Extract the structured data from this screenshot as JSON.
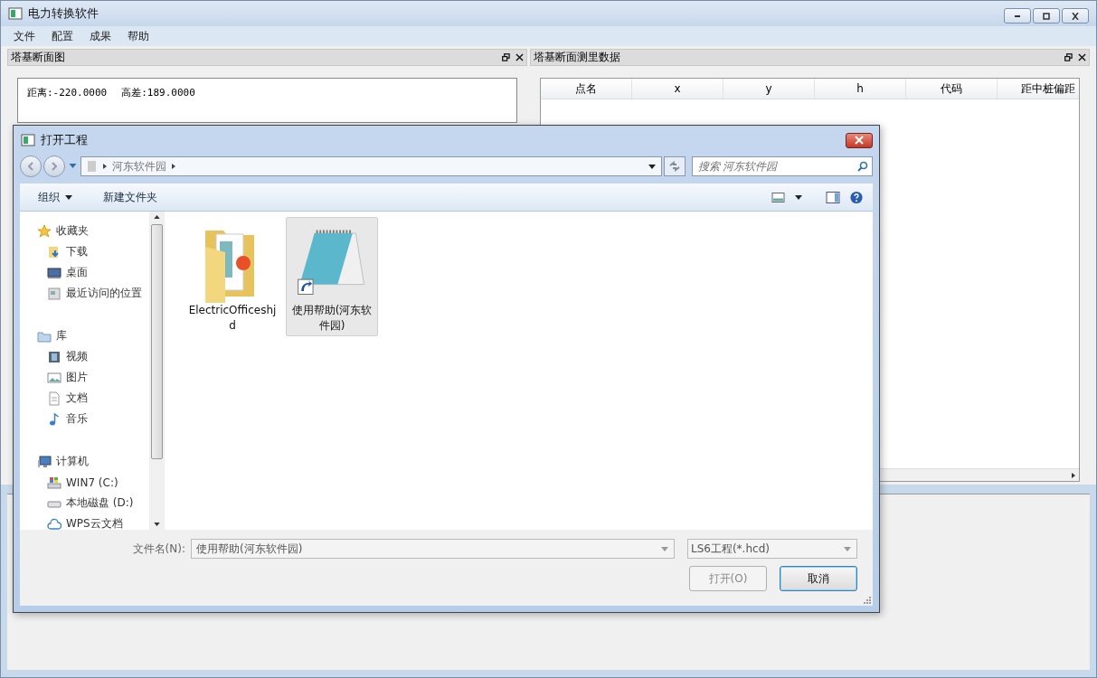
{
  "window": {
    "title": "电力转换软件"
  },
  "menu": [
    {
      "label": "文件"
    },
    {
      "label": "配置"
    },
    {
      "label": "成果"
    },
    {
      "label": "帮助"
    }
  ],
  "profile_panel": {
    "title": "塔基断面图",
    "readouts": [
      "距离:-220.0000",
      "高差:189.0000"
    ]
  },
  "data_panel": {
    "title": "塔基断面测里数据",
    "table": {
      "columns": [
        "点名",
        "x",
        "y",
        "h",
        "代码",
        "距中桩偏距"
      ]
    }
  },
  "dialog": {
    "title": "打开工程",
    "breadcrumb": [
      "河东软件园"
    ],
    "search": {
      "placeholder": "搜索 河东软件园"
    },
    "toolbar": [
      {
        "label": "组织",
        "dropdown": true
      },
      {
        "label": "新建文件夹",
        "dropdown": false
      }
    ],
    "nav": [
      {
        "label": "收藏夹",
        "kind": "star",
        "children": [
          {
            "label": "下载",
            "kind": "download"
          },
          {
            "label": "桌面",
            "kind": "desktop"
          },
          {
            "label": "最近访问的位置",
            "kind": "recent"
          }
        ]
      },
      {
        "label": "库",
        "kind": "library",
        "children": [
          {
            "label": "视频",
            "kind": "video"
          },
          {
            "label": "图片",
            "kind": "image"
          },
          {
            "label": "文档",
            "kind": "document"
          },
          {
            "label": "音乐",
            "kind": "music"
          }
        ]
      },
      {
        "label": "计算机",
        "kind": "computer",
        "children": [
          {
            "label": "WIN7 (C:)",
            "kind": "system"
          },
          {
            "label": "本地磁盘 (D:)",
            "kind": "drive"
          },
          {
            "label": "WPS云文档",
            "kind": "cloud"
          }
        ]
      }
    ],
    "files": [
      {
        "name": "ElectricOfficeshjd",
        "kind": "folder",
        "selected": false
      },
      {
        "name": "使用帮助(河东软件园)",
        "kind": "shortcut",
        "selected": true
      }
    ],
    "filename": {
      "label": "文件名(N):",
      "value": "使用帮助(河东软件园)"
    },
    "filter": {
      "value": "LS6工程(*.hcd)"
    },
    "buttons": [
      {
        "label": "打开(O)",
        "disabled": true,
        "default": false
      },
      {
        "label": "取消",
        "disabled": false,
        "default": true
      }
    ]
  }
}
